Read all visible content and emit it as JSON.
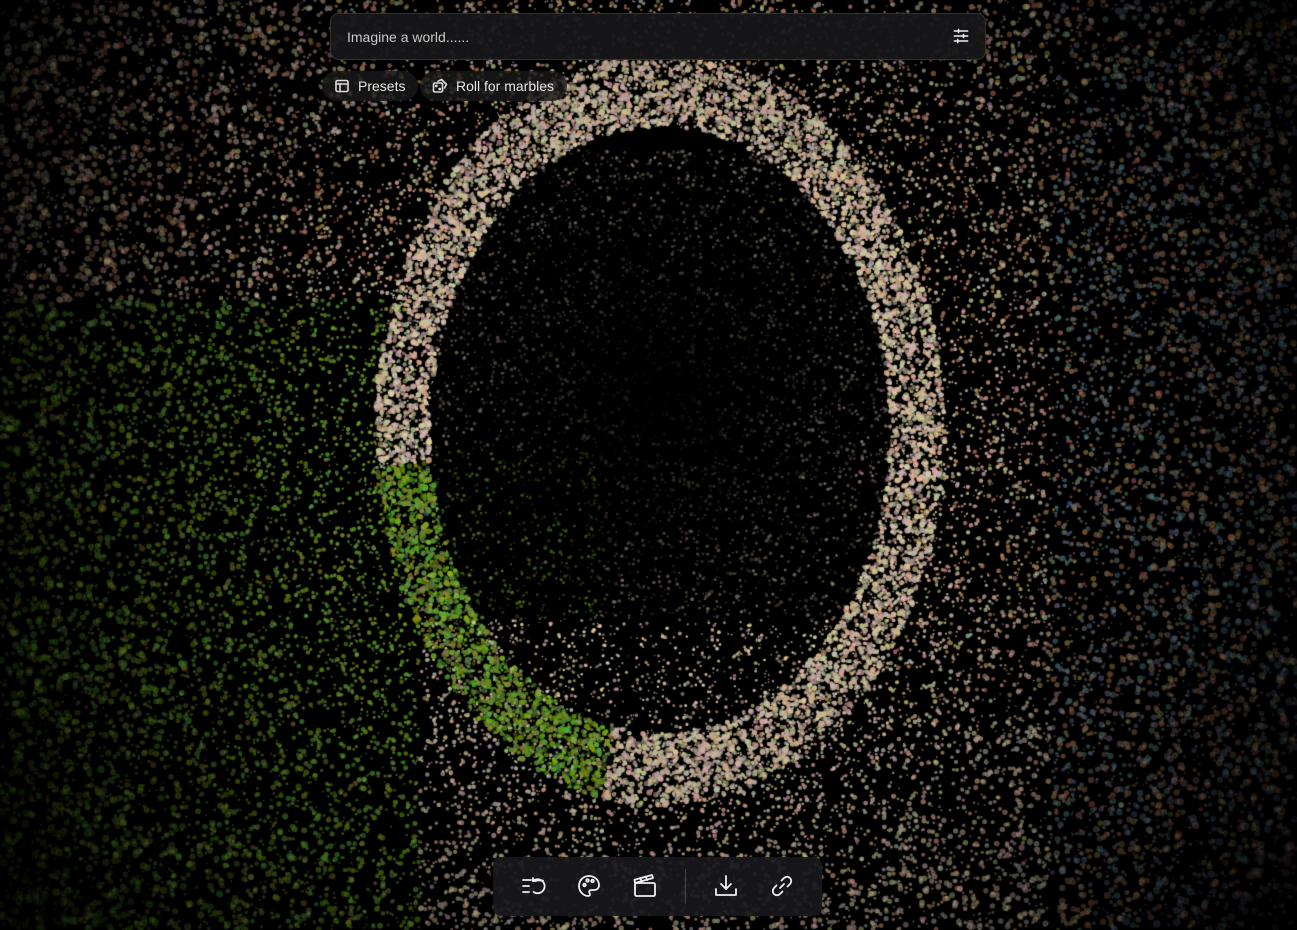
{
  "search": {
    "placeholder": "Imagine a world......",
    "settings_icon": "sliders-icon"
  },
  "chips": [
    {
      "label": "Presets",
      "icon": "layout-panel-icon"
    },
    {
      "label": "Roll for marbles",
      "icon": "dice-icon"
    }
  ],
  "toolbar": {
    "items": [
      {
        "name": "history-icon"
      },
      {
        "name": "palette-icon"
      },
      {
        "name": "clapperboard-icon"
      },
      {
        "name": "download-icon"
      },
      {
        "name": "link-icon"
      }
    ]
  },
  "scene": {
    "description_colors": {
      "foliage": "#6f9a2c",
      "stone": "#d8c2a6",
      "wall_cool": "#6a8a96",
      "wall_warm": "#b58660"
    }
  }
}
